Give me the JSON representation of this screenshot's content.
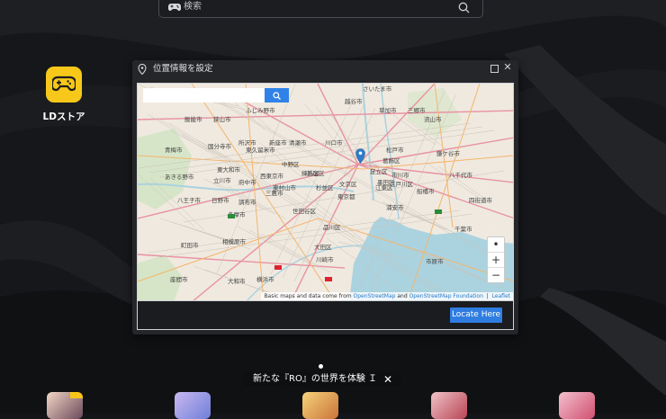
{
  "search": {
    "placeholder": "検索"
  },
  "desktop": {
    "app_label": "LDストア"
  },
  "dialog": {
    "title": "位置情報を設定",
    "locate_button": "Locate Here",
    "map": {
      "attribution_prefix": "Basic maps and data come from",
      "attribution_osm": "OpenStreetMap",
      "attribution_and": "and",
      "attribution_osmf": "OpenStreetMap Foundation",
      "attribution_leaflet": "Leaflet",
      "zoom_in": "+",
      "zoom_out": "−",
      "places": [
        "さいたま市",
        "越谷市",
        "ふじみ野市",
        "草加市",
        "三郷市",
        "流山市",
        "飯能市",
        "狭山市",
        "所沢市",
        "清瀬市",
        "新座市",
        "川口市",
        "松戸市",
        "鎌ケ谷市",
        "青梅市",
        "東久留米市",
        "西東京市",
        "練馬区",
        "足立区",
        "市川市",
        "八千代市",
        "東大和市",
        "葛飾区",
        "あきる野市",
        "立川市",
        "東村山市",
        "文京区",
        "墨田区",
        "江戸川区",
        "船橋市",
        "八王子市",
        "日野市",
        "三鷹市",
        "杉並区",
        "新宿区",
        "東京都",
        "浦安市",
        "四街道市",
        "多摩市",
        "世田谷区",
        "品川区",
        "千葉市",
        "相模原市",
        "大田区",
        "川崎市",
        "横浜市",
        "大和市",
        "市原市",
        "江東区",
        "中野区",
        "調布市",
        "府中市",
        "国分寺市",
        "町田市",
        "座間市"
      ]
    }
  },
  "banner": {
    "text": "新たな『RO』の世界を体験 Ｉ",
    "close": "✕"
  },
  "colors": {
    "accent": "#2f7de0",
    "app_tile": "#f7c81a",
    "background": "#141518"
  }
}
